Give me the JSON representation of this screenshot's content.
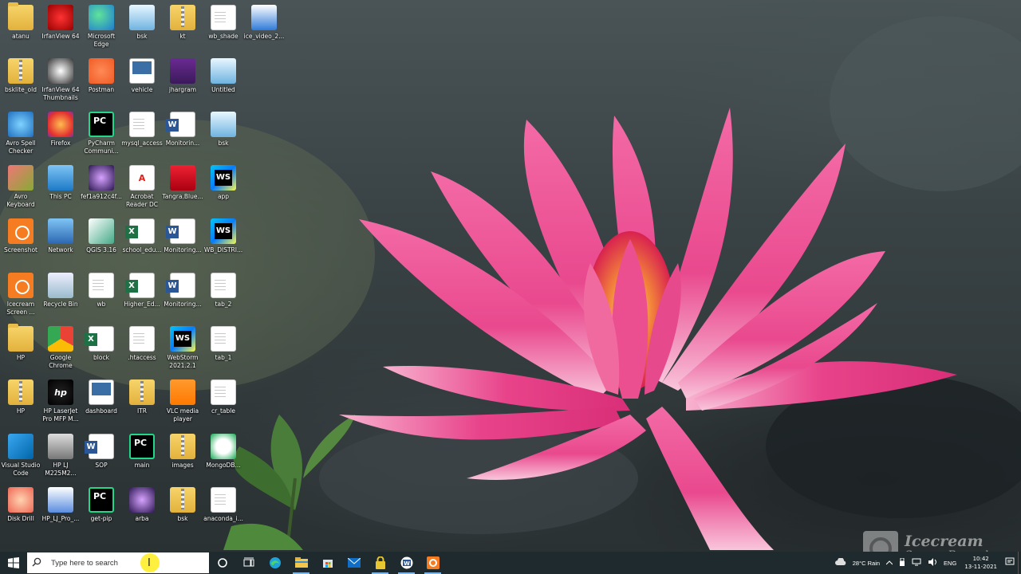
{
  "desktop": {
    "icons": [
      {
        "label": "atanu",
        "icon": "folder-icon"
      },
      {
        "label": "bsklite_old",
        "icon": "zip-folder-icon"
      },
      {
        "label": "Avro Spell Checker",
        "icon": "avro-spell-checker-icon"
      },
      {
        "label": "Avro Keyboard",
        "icon": "avro-keyboard-icon"
      },
      {
        "label": "Screenshot",
        "icon": "screenshot-icon"
      },
      {
        "label": "Icecream Screen ...",
        "icon": "icecream-screen-icon"
      },
      {
        "label": "HP",
        "icon": "folder-icon"
      },
      {
        "label": "HP",
        "icon": "zip-folder-icon"
      },
      {
        "label": "Visual Studio Code",
        "icon": "vscode-icon"
      },
      {
        "label": "Disk Drill",
        "icon": "disk-drill-icon"
      },
      {
        "label": "IrfanView 64",
        "icon": "irfanview-icon"
      },
      {
        "label": "IrfanView 64 Thumbnails",
        "icon": "irfanview-thumbnails-icon"
      },
      {
        "label": "Firefox",
        "icon": "firefox-icon"
      },
      {
        "label": "This PC",
        "icon": "this-pc-icon"
      },
      {
        "label": "Network",
        "icon": "network-icon"
      },
      {
        "label": "Recycle Bin",
        "icon": "recycle-bin-icon"
      },
      {
        "label": "Google Chrome",
        "icon": "chrome-icon"
      },
      {
        "label": "HP LaserJet Pro MFP M...",
        "icon": "hp-icon"
      },
      {
        "label": "HP LJ M225M2...",
        "icon": "scanner-icon"
      },
      {
        "label": "HP_LJ_Pro_...",
        "icon": "hp-printer-tool-icon"
      },
      {
        "label": "Microsoft Edge",
        "icon": "edge-icon"
      },
      {
        "label": "Postman",
        "icon": "postman-icon"
      },
      {
        "label": "PyCharm Communi...",
        "icon": "pycharm-icon"
      },
      {
        "label": "fef1a912c4f...",
        "icon": "image-file-icon"
      },
      {
        "label": "QGIS 3.16",
        "icon": "qgis-icon"
      },
      {
        "label": "wb",
        "icon": "document-icon"
      },
      {
        "label": "block",
        "icon": "excel-file-icon"
      },
      {
        "label": "dashboard",
        "icon": "web-file-icon"
      },
      {
        "label": "SOP",
        "icon": "word-file-icon"
      },
      {
        "label": "get-pip",
        "icon": "pycharm-file-icon"
      },
      {
        "label": "bsk",
        "icon": "bsk-file-icon"
      },
      {
        "label": "vehicle",
        "icon": "vehicle-file-icon"
      },
      {
        "label": "mysql_access",
        "icon": "document-icon"
      },
      {
        "label": "Acrobat Reader DC",
        "icon": "acrobat-icon"
      },
      {
        "label": "school_edu...",
        "icon": "excel-file-icon"
      },
      {
        "label": "Higher_Ed...",
        "icon": "excel-file-icon"
      },
      {
        "label": ".htaccess",
        "icon": "document-icon"
      },
      {
        "label": "ITR",
        "icon": "zip-folder-icon"
      },
      {
        "label": "main",
        "icon": "pycharm-file-icon"
      },
      {
        "label": "arba",
        "icon": "image-file-icon"
      },
      {
        "label": "kt",
        "icon": "zip-folder-icon"
      },
      {
        "label": "jhargram",
        "icon": "firefox-file-icon"
      },
      {
        "label": "Monitorin...",
        "icon": "word-file-icon"
      },
      {
        "label": "Tangra.Blue...",
        "icon": "tangra-icon"
      },
      {
        "label": "Monitoring...",
        "icon": "word-file-icon"
      },
      {
        "label": "Monitoring...",
        "icon": "word-file-icon"
      },
      {
        "label": "WebStorm 2021.2.1",
        "icon": "webstorm-icon"
      },
      {
        "label": "VLC media player",
        "icon": "vlc-icon"
      },
      {
        "label": "images",
        "icon": "zip-folder-icon"
      },
      {
        "label": "bsk",
        "icon": "zip-folder-icon"
      },
      {
        "label": "wb_shade",
        "icon": "document-icon"
      },
      {
        "label": "Untitled",
        "icon": "bsk-file-icon"
      },
      {
        "label": "bsk",
        "icon": "bsk-file-icon"
      },
      {
        "label": "app",
        "icon": "webstorm-file-icon"
      },
      {
        "label": "WB_DISTRI...",
        "icon": "webstorm-file-icon"
      },
      {
        "label": "tab_2",
        "icon": "zip-document-icon"
      },
      {
        "label": "tab_1",
        "icon": "zip-document-icon"
      },
      {
        "label": "cr_table",
        "icon": "zip-document-icon"
      },
      {
        "label": "MongoDB...",
        "icon": "mongodb-icon"
      },
      {
        "label": "anaconda_i...",
        "icon": "document-icon"
      },
      {
        "label": "ice_video_2...",
        "icon": "video-file-icon"
      }
    ]
  },
  "taskbar": {
    "start_icon": "windows-start-icon",
    "search_placeholder": "Type here to search",
    "pinned": [
      {
        "name": "cortana-icon"
      },
      {
        "name": "task-view-icon"
      },
      {
        "name": "edge-icon"
      },
      {
        "name": "file-explorer-icon"
      },
      {
        "name": "store-icon"
      },
      {
        "name": "mail-icon"
      },
      {
        "name": "lock-app-icon"
      },
      {
        "name": "word-icon"
      },
      {
        "name": "icecream-recorder-icon"
      }
    ],
    "tray": {
      "weather": "28°C  Rain",
      "language": "ENG",
      "time": "10:42",
      "date": "13-11-2021"
    }
  },
  "watermark": {
    "line1": "Icecream",
    "line2": "Screen Recorder"
  },
  "colors": {
    "taskbar": "#1f2a2e",
    "lotus_pink": "#e94b8f",
    "search_highlight": "#ffeb00"
  }
}
